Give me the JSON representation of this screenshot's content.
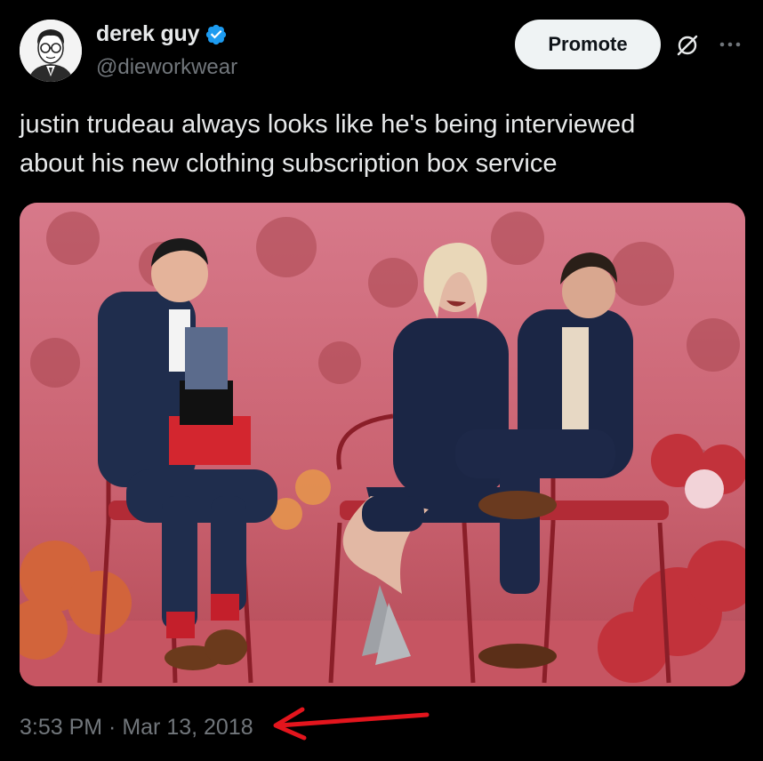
{
  "author": {
    "display_name": "derek guy",
    "handle": "@dieworkwear",
    "verified": true
  },
  "actions": {
    "promote_label": "Promote"
  },
  "icons": {
    "verified": "verified-badge-icon",
    "grok": "grok-icon",
    "more": "more-options-icon",
    "annotation": "red-arrow-icon"
  },
  "tweet": {
    "text": "justin trudeau always looks like he's being interviewed\nabout his new clothing subscription box service",
    "timestamp": "3:53 PM · Mar 13, 2018"
  },
  "colors": {
    "background": "#000000",
    "primary_text": "#e7e9ea",
    "secondary_text": "#71767b",
    "verified_blue": "#1d9bf0",
    "promote_bg": "#eff3f4",
    "annotation_red": "#e3151d"
  }
}
